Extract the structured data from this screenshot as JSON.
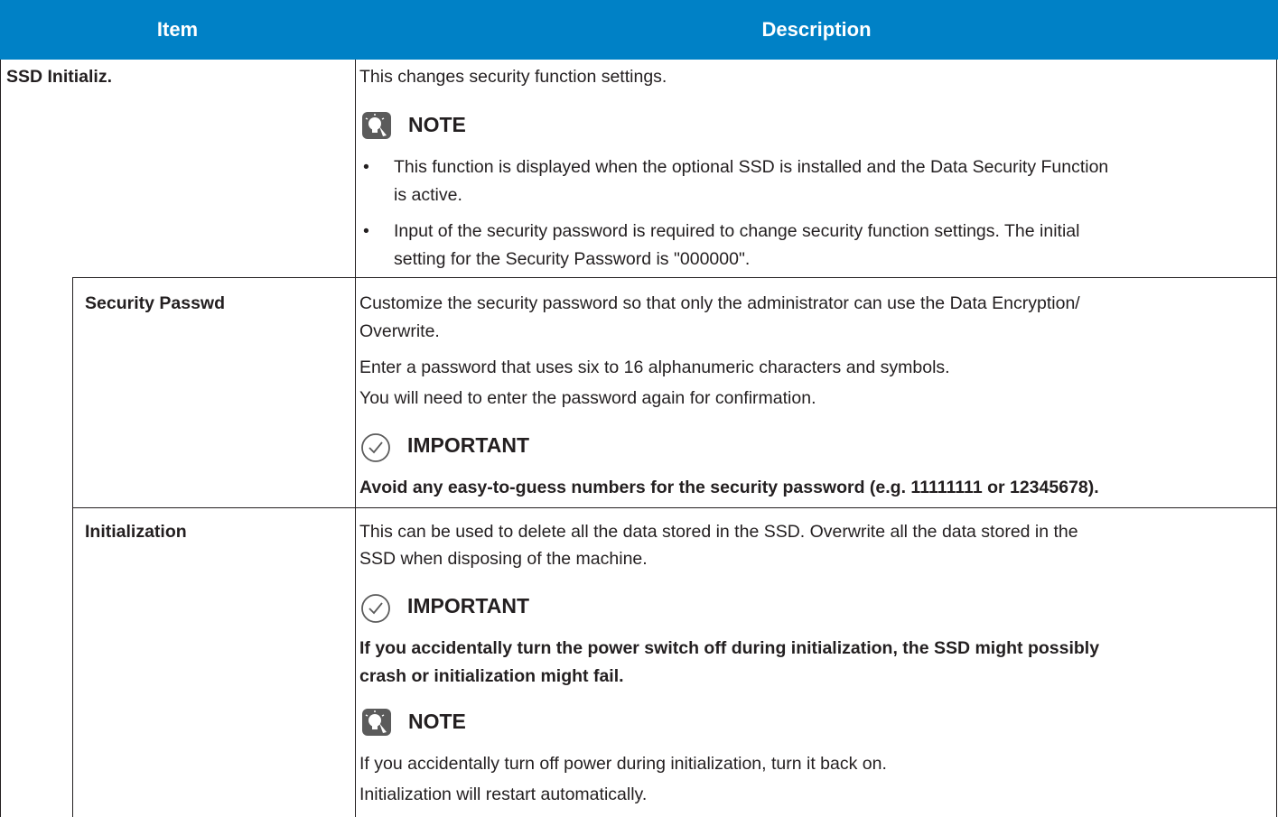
{
  "header": {
    "item": "Item",
    "description": "Description"
  },
  "rows": {
    "ssd": {
      "item": "SSD Initializ.",
      "desc": "This changes security function settings.",
      "note_title": "NOTE",
      "bullets": [
        [
          "This function is displayed when the optional SSD is installed and the Data Security Function",
          "is active."
        ],
        [
          "Input of the security password is required to change security function settings. The initial",
          "setting for the Security Password is \"000000\"."
        ]
      ]
    },
    "passwd": {
      "item": "Security Passwd",
      "desc": [
        "Customize the security password so that only the administrator can use the Data Encryption/",
        "Overwrite."
      ],
      "desc2": "Enter a password that uses six to 16 alphanumeric characters and symbols.",
      "desc3": "You will need to enter the password again for confirmation.",
      "important_title": "IMPORTANT",
      "important_text": "Avoid any easy-to-guess numbers for the security password (e.g. 11111111 or 12345678)."
    },
    "init": {
      "item": "Initialization",
      "desc": [
        "This can be used to delete all the data stored in the SSD. Overwrite all the data stored in the",
        "SSD when disposing of the machine."
      ],
      "important_title": "IMPORTANT",
      "important_text": [
        "If you accidentally turn the power switch off during initialization, the SSD might possibly",
        "crash or initialization might fail."
      ],
      "note_title": "NOTE",
      "note1": "If you accidentally turn off power during initialization, turn it back on.",
      "note2": "Initialization will restart automatically."
    }
  },
  "colors": {
    "header_bg": "#0081c6",
    "header_text": "#ffffff",
    "text": "#231f20"
  },
  "icons": {
    "note": "lightbulb-note-icon",
    "important": "checkmark-circle-icon"
  }
}
